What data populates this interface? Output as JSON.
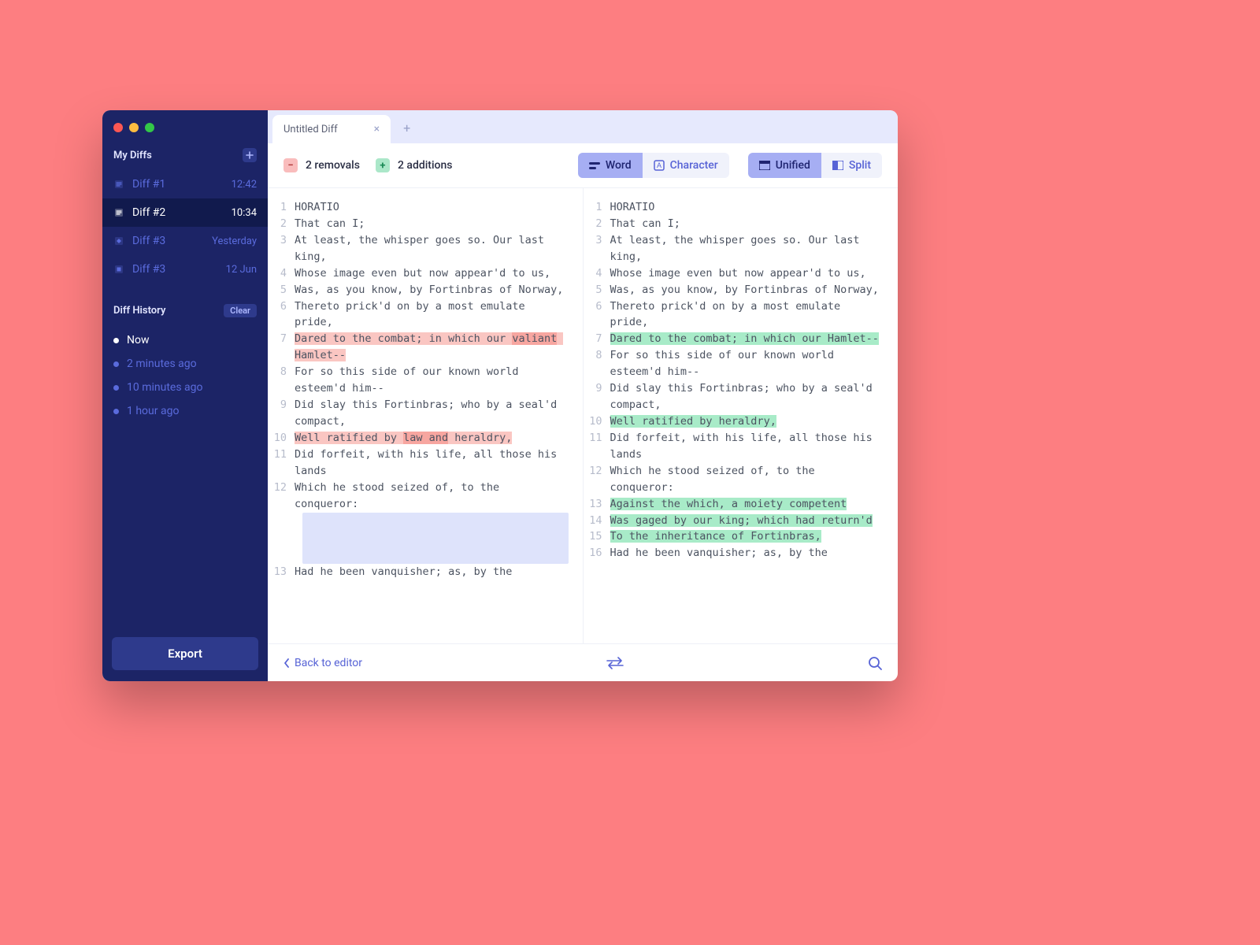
{
  "sidebar": {
    "myDiffsLabel": "My Diffs",
    "diffHistoryLabel": "Diff History",
    "clearLabel": "Clear",
    "exportLabel": "Export",
    "items": [
      {
        "label": "Diff #1",
        "time": "12:42"
      },
      {
        "label": "Diff #2",
        "time": "10:34"
      },
      {
        "label": "Diff #3",
        "time": "Yesterday"
      },
      {
        "label": "Diff #3",
        "time": "12 Jun"
      }
    ],
    "history": [
      {
        "label": "Now"
      },
      {
        "label": "2 minutes ago"
      },
      {
        "label": "10 minutes ago"
      },
      {
        "label": "1 hour ago"
      }
    ]
  },
  "tabs": {
    "active": "Untitled Diff"
  },
  "toolbar": {
    "removals": "2 removals",
    "additions": "2 additions",
    "word": "Word",
    "character": "Character",
    "unified": "Unified",
    "split": "Split"
  },
  "footer": {
    "back": "Back to editor"
  },
  "diff": {
    "left": [
      {
        "n": "1",
        "text": "HORATIO"
      },
      {
        "n": "2",
        "text": "That can I;"
      },
      {
        "n": "3",
        "text": "At least, the whisper goes so. Our last king,"
      },
      {
        "n": "4",
        "text": "Whose image even but now appear'd to us,"
      },
      {
        "n": "5",
        "text": "Was, as you know, by Fortinbras of Norway,"
      },
      {
        "n": "6",
        "text": "Thereto prick'd on by a most emulate pride,"
      },
      {
        "n": "7",
        "segments": [
          {
            "t": "Dared to the combat; in which our ",
            "cls": "hl-red"
          },
          {
            "t": "valiant",
            "cls": "hl-red-strong"
          },
          {
            "t": " Hamlet--",
            "cls": "hl-red"
          }
        ]
      },
      {
        "n": "8",
        "text": "For so this side of our known world esteem'd him--"
      },
      {
        "n": "9",
        "text": "Did slay this Fortinbras; who by a seal'd compact,"
      },
      {
        "n": "10",
        "segments": [
          {
            "t": "Well ratified by ",
            "cls": "hl-red"
          },
          {
            "t": "law and",
            "cls": "hl-red-strong"
          },
          {
            "t": " heraldry,",
            "cls": "hl-red"
          }
        ]
      },
      {
        "n": "11",
        "text": "Did forfeit, with his life, all those his lands"
      },
      {
        "n": "12",
        "text": "Which he stood seized of, to the conqueror:"
      },
      {
        "filler": true
      },
      {
        "n": "13",
        "text": "Had he been vanquisher; as, by the"
      }
    ],
    "right": [
      {
        "n": "1",
        "text": "HORATIO"
      },
      {
        "n": "2",
        "text": "That can I;"
      },
      {
        "n": "3",
        "text": "At least, the whisper goes so. Our last king,"
      },
      {
        "n": "4",
        "text": "Whose image even but now appear'd to us,"
      },
      {
        "n": "5",
        "text": "Was, as you know, by Fortinbras of Norway,"
      },
      {
        "n": "6",
        "text": "Thereto prick'd on by a most emulate pride,"
      },
      {
        "n": "7",
        "segments": [
          {
            "t": "Dared to the combat; in which our Hamlet--",
            "cls": "hl-green"
          }
        ]
      },
      {
        "n": "8",
        "text": "For so this side of our known world esteem'd him--"
      },
      {
        "n": "9",
        "text": "Did slay this Fortinbras; who by a seal'd compact,"
      },
      {
        "n": "10",
        "segments": [
          {
            "t": "Well ratified by heraldry,",
            "cls": "hl-green"
          }
        ]
      },
      {
        "n": "11",
        "text": "Did forfeit, with his life, all those his lands"
      },
      {
        "n": "12",
        "text": "Which he stood seized of, to the conqueror:"
      },
      {
        "n": "13",
        "segments": [
          {
            "t": "Against the which, a moiety competent",
            "cls": "hl-green"
          }
        ]
      },
      {
        "n": "14",
        "segments": [
          {
            "t": "Was gaged by our king; which had return'd",
            "cls": "hl-green"
          }
        ]
      },
      {
        "n": "15",
        "segments": [
          {
            "t": "To the inheritance of Fortinbras,",
            "cls": "hl-green"
          }
        ]
      },
      {
        "n": "16",
        "text": "Had he been vanquisher; as, by the"
      }
    ]
  }
}
